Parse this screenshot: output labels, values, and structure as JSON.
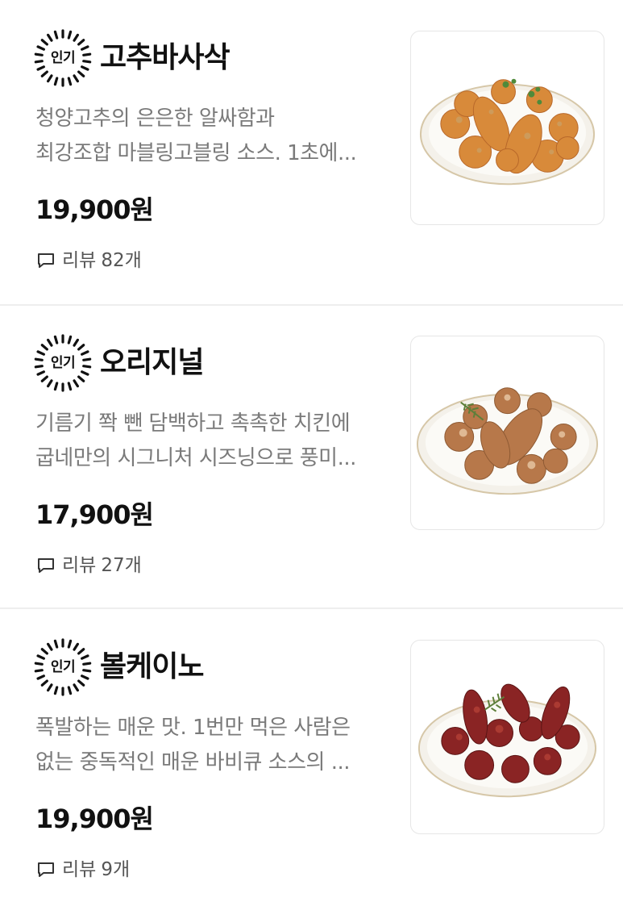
{
  "menu": {
    "items": [
      {
        "badge": "인기",
        "name": "고추바사삭",
        "desc_line1": "청양고추의 은은한 알싸함과",
        "desc_line2": "최강조합 마블링고블링 소스. 1초에...",
        "price": "19,900원",
        "review_label": "리뷰",
        "review_count": "82개",
        "image": "gochu-basasak-fried-chicken-plate"
      },
      {
        "badge": "인기",
        "name": "오리지널",
        "desc_line1": "기름기 쫙 뺀 담백하고 촉촉한 치킨에",
        "desc_line2": "굽네만의 시그니처 시즈닝으로 풍미...",
        "price": "17,900원",
        "review_label": "리뷰",
        "review_count": "27개",
        "image": "original-roasted-chicken-plate"
      },
      {
        "badge": "인기",
        "name": "볼케이노",
        "desc_line1": "폭발하는 매운 맛. 1번만 먹은 사람은",
        "desc_line2": "없는 중독적인 매운 바비큐 소스의 ...",
        "price": "19,900원",
        "review_label": "리뷰",
        "review_count": "9개",
        "image": "volcano-spicy-bbq-chicken-plate"
      }
    ]
  },
  "icons": {
    "review": "speech-bubble-icon",
    "badge": "sunburst-badge-icon"
  },
  "colors": {
    "text": "#111111",
    "desc": "#7a7a7a",
    "review": "#555555",
    "divider": "#eeeeee",
    "chicken_crispy": "#d88a3a",
    "chicken_roast": "#b7784a",
    "chicken_volcano": "#8a2424"
  }
}
